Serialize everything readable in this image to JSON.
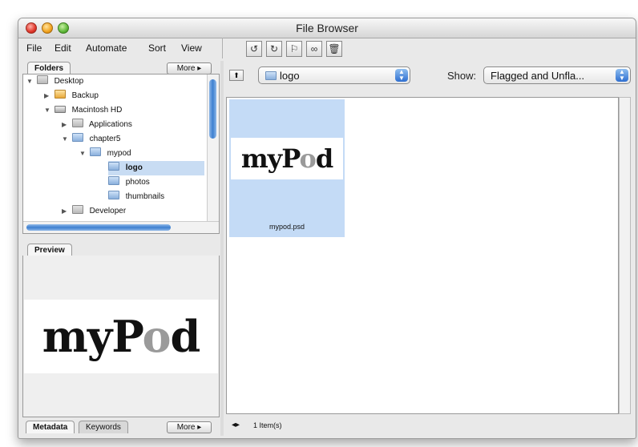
{
  "window": {
    "title": "File Browser"
  },
  "menu": {
    "items": [
      "File",
      "Edit",
      "Automate",
      "Sort",
      "View"
    ]
  },
  "toolbar": {
    "buttons": [
      {
        "icon": "rotate-ccw-icon",
        "glyph": "↺"
      },
      {
        "icon": "rotate-cw-icon",
        "glyph": "↻"
      },
      {
        "icon": "flag-icon",
        "glyph": "⚐"
      },
      {
        "icon": "binoculars-icon",
        "glyph": "∞"
      },
      {
        "icon": "trash-icon",
        "glyph": "🗑"
      }
    ]
  },
  "folders_panel": {
    "tab_label": "Folders",
    "more_label": "More ▸",
    "tree": [
      {
        "label": "Desktop",
        "icon": "desktop-icon",
        "expanded": true,
        "depth": 0
      },
      {
        "label": "Backup",
        "icon": "folder-icon",
        "expanded": false,
        "depth": 1
      },
      {
        "label": "Macintosh HD",
        "icon": "hard-disk-icon",
        "expanded": true,
        "depth": 1
      },
      {
        "label": "Applications",
        "icon": "applications-folder-icon",
        "expanded": false,
        "depth": 2
      },
      {
        "label": "chapter5",
        "icon": "folder-icon",
        "expanded": true,
        "depth": 2
      },
      {
        "label": "mypod",
        "icon": "folder-icon",
        "expanded": true,
        "depth": 3
      },
      {
        "label": "logo",
        "icon": "folder-icon",
        "selected": true,
        "depth": 4
      },
      {
        "label": "photos",
        "icon": "folder-icon",
        "depth": 4
      },
      {
        "label": "thumbnails",
        "icon": "folder-icon",
        "depth": 4
      },
      {
        "label": "Developer",
        "icon": "developer-folder-icon",
        "expanded": false,
        "depth": 2
      }
    ]
  },
  "preview_panel": {
    "tab_label": "Preview",
    "logo_text_a": "myP",
    "logo_text_o": "o",
    "logo_text_b": "d"
  },
  "bottom_tabs": {
    "metadata_label": "Metadata",
    "keywords_label": "Keywords",
    "more_label": "More ▸"
  },
  "location": {
    "current_folder": "logo"
  },
  "filter": {
    "label": "Show:",
    "value": "Flagged and Unfla..."
  },
  "files": [
    {
      "name": "mypod.psd"
    }
  ],
  "status": {
    "item_count": "1 Item(s)"
  },
  "colors": {
    "selection": "#c4dbf6",
    "accent": "#3d7fd0"
  }
}
